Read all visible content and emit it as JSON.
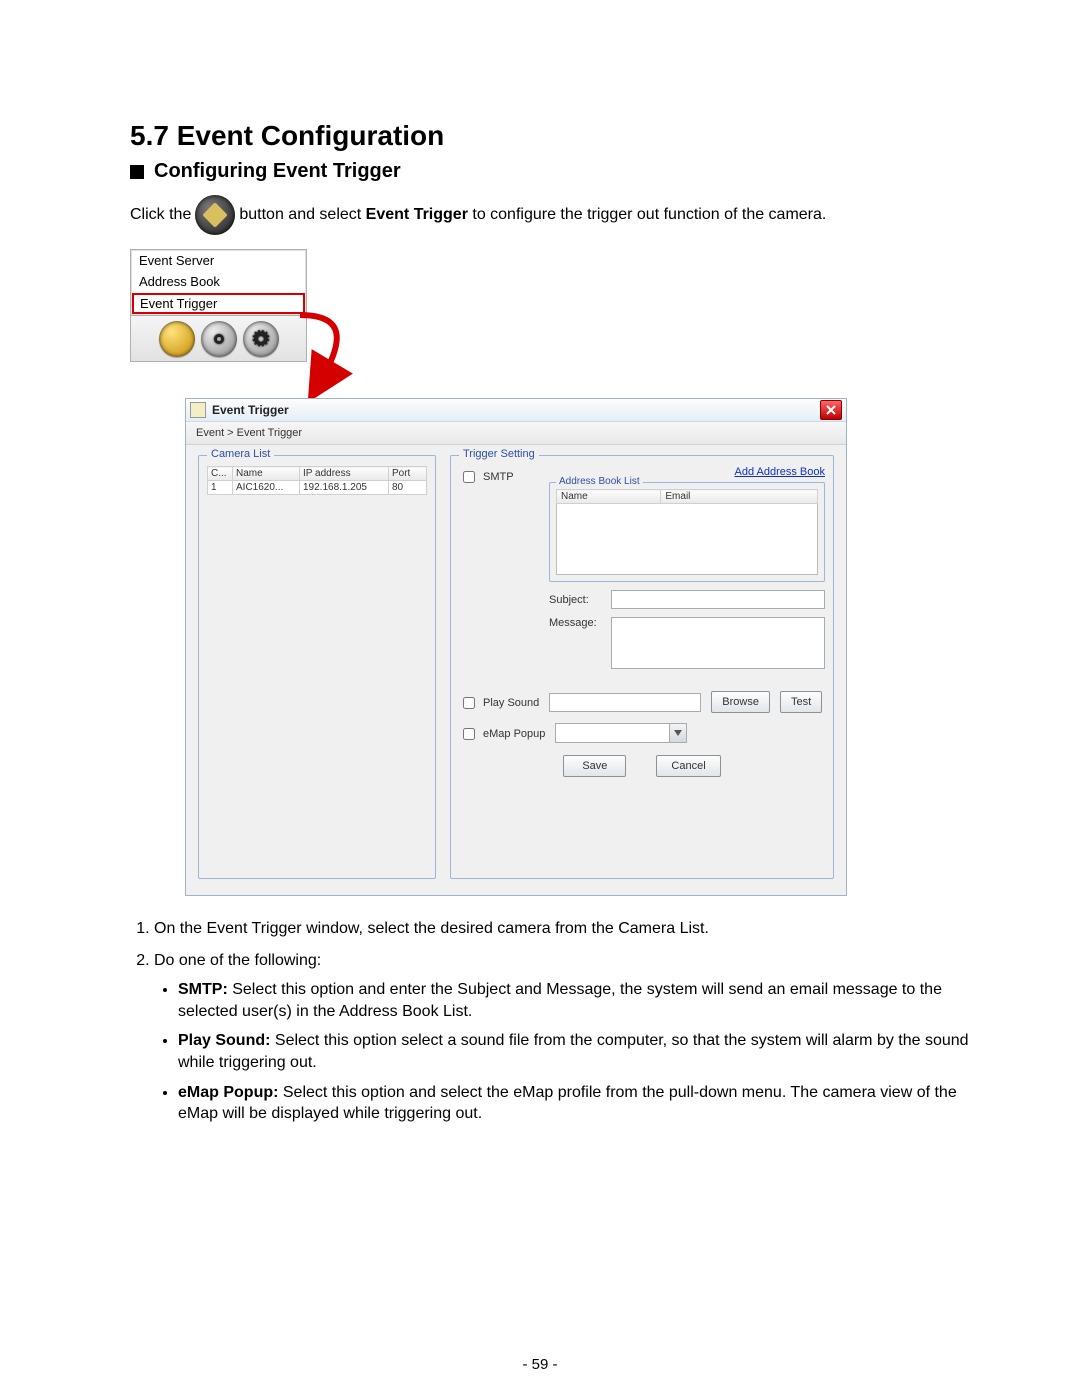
{
  "doc": {
    "section_title": "5.7  Event Configuration",
    "subhead": "Configuring Event Trigger",
    "intro_pre": "Click the",
    "intro_post_1": "button and select ",
    "intro_bold": "Event Trigger",
    "intro_post_2": " to configure the trigger out function of the camera.",
    "page_number": "- 59 -"
  },
  "menu": {
    "items": [
      "Event Server",
      "Address Book",
      "Event Trigger"
    ],
    "selected_index": 2
  },
  "dialog": {
    "title": "Event Trigger",
    "breadcrumb": "Event > Event Trigger",
    "camera_list": {
      "legend": "Camera List",
      "cols": [
        "C...",
        "Name",
        "IP address",
        "Port"
      ],
      "rows": [
        [
          "1",
          "AIC1620...",
          "192.168.1.205",
          "80"
        ]
      ]
    },
    "trigger_setting": {
      "legend": "Trigger Setting",
      "add_link": "Add Address Book",
      "smtp_label": "SMTP",
      "address_book_list": {
        "legend": "Address Book List",
        "cols": [
          "Name",
          "Email"
        ]
      },
      "subject_label": "Subject:",
      "message_label": "Message:",
      "play_sound_label": "Play Sound",
      "browse_label": "Browse",
      "test_label": "Test",
      "emap_label": "eMap Popup",
      "save_label": "Save",
      "cancel_label": "Cancel"
    }
  },
  "steps": {
    "s1": "On the Event Trigger window, select the desired camera from the Camera List.",
    "s2": "Do one of the following:",
    "smtp_b": "SMTP:",
    "smtp_t": " Select this option and enter the Subject and Message, the system will send an email message to the selected user(s) in the Address Book List.",
    "ps_b": "Play Sound:",
    "ps_t": " Select this option select a sound file from the computer, so that the system will alarm by the sound while triggering out.",
    "em_b": "eMap Popup:",
    "em_t": " Select this option and select the eMap profile from the pull-down menu. The camera view of the eMap will be displayed while triggering out."
  }
}
